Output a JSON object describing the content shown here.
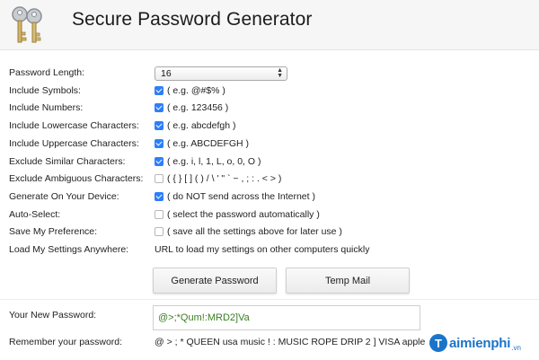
{
  "app": {
    "title": "Secure Password Generator"
  },
  "options": [
    {
      "label": "Password Length:",
      "type": "select",
      "value": "16"
    },
    {
      "label": "Include Symbols:",
      "type": "checkbox",
      "checked": true,
      "hint": "( e.g. @#$% )"
    },
    {
      "label": "Include Numbers:",
      "type": "checkbox",
      "checked": true,
      "hint": "( e.g. 123456 )"
    },
    {
      "label": "Include Lowercase Characters:",
      "type": "checkbox",
      "checked": true,
      "hint": "( e.g. abcdefgh )"
    },
    {
      "label": "Include Uppercase Characters:",
      "type": "checkbox",
      "checked": true,
      "hint": "( e.g. ABCDEFGH )"
    },
    {
      "label": "Exclude Similar Characters:",
      "type": "checkbox",
      "checked": true,
      "hint": "( e.g. i, l, 1, L, o, 0, O )"
    },
    {
      "label": "Exclude Ambiguous Characters:",
      "type": "checkbox",
      "checked": false,
      "hint": "( { } [ ] ( ) / \\ ' \" ` ~ , ; : . < > )"
    },
    {
      "label": "Generate On Your Device:",
      "type": "checkbox",
      "checked": true,
      "hint": "( do NOT send across the Internet )"
    },
    {
      "label": "Auto-Select:",
      "type": "checkbox",
      "checked": false,
      "hint": "( select the password automatically )"
    },
    {
      "label": "Save My Preference:",
      "type": "checkbox",
      "checked": false,
      "hint": "( save all the settings above for later use )"
    },
    {
      "label": "Load My Settings Anywhere:",
      "type": "text",
      "hint": "URL to load my settings on other computers quickly"
    }
  ],
  "buttons": {
    "generate": "Generate Password",
    "temp_mail": "Temp Mail"
  },
  "result": {
    "new_password_label": "Your New Password:",
    "new_password_value": "@>;*Qum!:MRD2]Va",
    "remember_label": "Remember your password:",
    "remember_value": "@ > ; * QUEEN usa music ! : MUSIC ROPE DRIP 2 ] VISA apple"
  },
  "watermark": {
    "letter": "T",
    "text": "aimienphi",
    "suffix": ".vn"
  },
  "colors": {
    "checkbox": "#2d7ff9",
    "password_text": "#3a7d22",
    "watermark": "#1b74c9"
  }
}
